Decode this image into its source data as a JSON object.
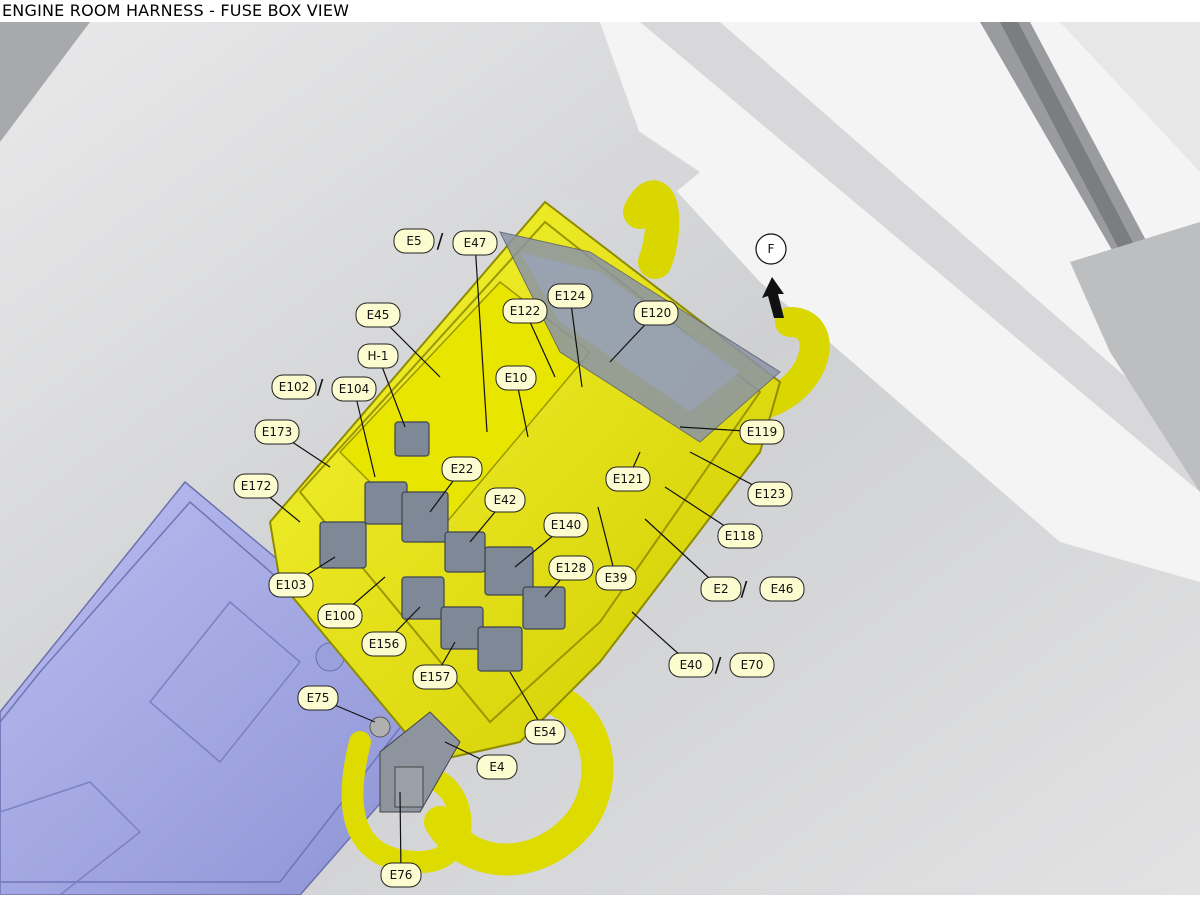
{
  "title": "ENGINE ROOM HARNESS - FUSE BOX VIEW",
  "direction_marker": "F",
  "separator": "/",
  "colors": {
    "harness": "#f2f011",
    "harness_dark": "#b8b400",
    "battery": "#a9aee6",
    "relay": "#7d8796",
    "background_grey": "#c9cacc"
  },
  "connectors": [
    {
      "id": "E5",
      "label": "E5"
    },
    {
      "id": "E47",
      "label": "E47"
    },
    {
      "id": "E45",
      "label": "E45"
    },
    {
      "id": "E124",
      "label": "E124"
    },
    {
      "id": "E122",
      "label": "E122"
    },
    {
      "id": "E120",
      "label": "E120"
    },
    {
      "id": "H-1",
      "label": "H-1"
    },
    {
      "id": "E102",
      "label": "E102"
    },
    {
      "id": "E104",
      "label": "E104"
    },
    {
      "id": "E10",
      "label": "E10"
    },
    {
      "id": "E173",
      "label": "E173"
    },
    {
      "id": "E119",
      "label": "E119"
    },
    {
      "id": "E22",
      "label": "E22"
    },
    {
      "id": "E121",
      "label": "E121"
    },
    {
      "id": "E172",
      "label": "E172"
    },
    {
      "id": "E123",
      "label": "E123"
    },
    {
      "id": "E42",
      "label": "E42"
    },
    {
      "id": "E140",
      "label": "E140"
    },
    {
      "id": "E118",
      "label": "E118"
    },
    {
      "id": "E128",
      "label": "E128"
    },
    {
      "id": "E39",
      "label": "E39"
    },
    {
      "id": "E103",
      "label": "E103"
    },
    {
      "id": "E2",
      "label": "E2"
    },
    {
      "id": "E46",
      "label": "E46"
    },
    {
      "id": "E100",
      "label": "E100"
    },
    {
      "id": "E156",
      "label": "E156"
    },
    {
      "id": "E40",
      "label": "E40"
    },
    {
      "id": "E70",
      "label": "E70"
    },
    {
      "id": "E157",
      "label": "E157"
    },
    {
      "id": "E75",
      "label": "E75"
    },
    {
      "id": "E54",
      "label": "E54"
    },
    {
      "id": "E4",
      "label": "E4"
    },
    {
      "id": "E76",
      "label": "E76"
    }
  ]
}
